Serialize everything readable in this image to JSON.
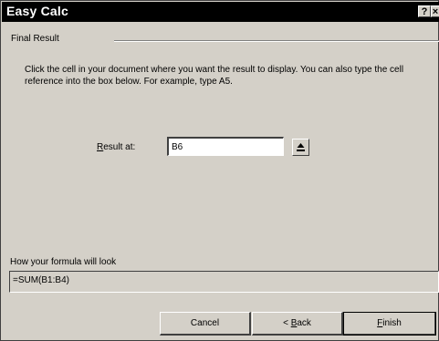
{
  "window": {
    "title": "Easy Calc",
    "help_label": "?",
    "close_label": "×"
  },
  "section": {
    "title": "Final Result"
  },
  "instructions": "Click the cell in your document where you want the result to display.  You can also type the cell reference into the box below. For example, type A5.",
  "result": {
    "label_first": "R",
    "label_rest": "esult at:",
    "value": "B6"
  },
  "formula": {
    "label": "How your formula will look",
    "value": "=SUM(B1:B4)"
  },
  "buttons": {
    "cancel": "Cancel",
    "back_prefix": "< ",
    "back_first": "B",
    "back_rest": "ack",
    "finish_first": "F",
    "finish_rest": "inish"
  }
}
